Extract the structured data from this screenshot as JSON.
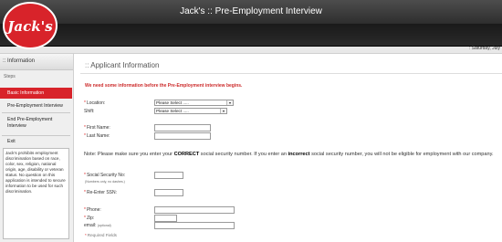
{
  "window": {
    "title": "Jack's :: Pre-Employment Interview"
  },
  "brand": {
    "logo_text": "Jack's",
    "color": "#d8232a"
  },
  "date_text": ": Saturday, July",
  "sidebar": {
    "heading": ":: Information",
    "steps_label": "Steps",
    "items": [
      {
        "label": "Basic Information",
        "active": true
      },
      {
        "label": "Pre-Employment Interview",
        "active": false
      },
      {
        "label": "End Pre-Employment Interview",
        "active": false
      },
      {
        "label": "Exit",
        "active": false
      }
    ],
    "notice": "Jack's prohibits employment discrimination based on race, color, sex, religion, national origin, age, disability or veteran status. No question on this application is intended to secure information to be used for such discrimination."
  },
  "main": {
    "title": "Applicant Information",
    "intro": "We need some information before the Pre-Employment interview begins.",
    "location": {
      "label": "Location:",
      "value": "Please Select ....."
    },
    "shift": {
      "label": "Shift:",
      "value": "Please Select ....."
    },
    "first_name": {
      "label": "First Name:",
      "value": ""
    },
    "last_name": {
      "label": "Last Name:",
      "value": ""
    },
    "note_pre": "Note: Please make sure you enter your ",
    "note_correct": "CORRECT",
    "note_mid": " social security number. If you enter an ",
    "note_incorrect": "incorrect",
    "note_post": " social security number, you will not be eligible for employment with our company.",
    "ssn": {
      "label": "Social Security No:",
      "hint": "(Numbers only, no dashes.)",
      "value": ""
    },
    "ssn_reenter": {
      "label": "Re-Enter SSN:",
      "value": ""
    },
    "phone": {
      "label": "Phone:",
      "value": ""
    },
    "zip": {
      "label": "Zip:",
      "value": ""
    },
    "email": {
      "label": "email:",
      "hint": "(optional)",
      "value": ""
    },
    "required_note": "Required Fields"
  }
}
